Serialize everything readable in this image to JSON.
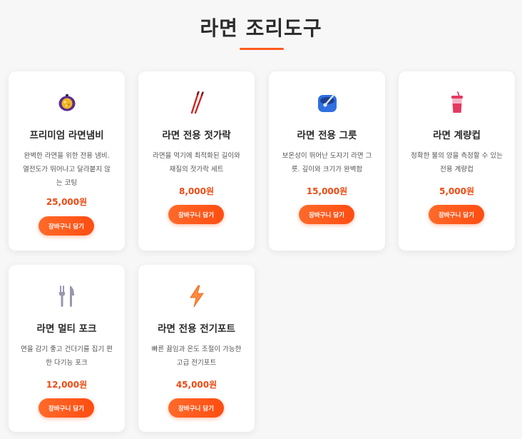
{
  "page": {
    "title": "라면 조리도구"
  },
  "colors": {
    "accent": "#ff5a1f",
    "price": "#ee4a12",
    "card_bg": "#ffffff",
    "page_bg": "#f7f7f7"
  },
  "products": [
    {
      "name": "프리미엄 라면냄비",
      "description": "완벽한 라면을 위한 전용 냄비. 열전도가 뛰어나고 달라붙지 않는 코팅",
      "price": "25,000원",
      "button_label": "장바구니 담기",
      "icon": "pot-icon"
    },
    {
      "name": "라면 전용 젓가락",
      "description": "라면을 먹기에 최적화된 길이와 재질의 젓가락 세트",
      "price": "8,000원",
      "button_label": "장바구니 담기",
      "icon": "chopsticks-icon"
    },
    {
      "name": "라면 전용 그릇",
      "description": "보온성이 뛰어난 도자기 라면 그릇. 깊이와 크기가 완벽함",
      "price": "15,000원",
      "button_label": "장바구니 담기",
      "icon": "bowl-icon"
    },
    {
      "name": "라면 계량컵",
      "description": "정확한 물의 양을 측정할 수 있는 전용 계량컵",
      "price": "5,000원",
      "button_label": "장바구니 담기",
      "icon": "cup-icon"
    },
    {
      "name": "라면 멀티 포크",
      "description": "면을 감기 좋고 건더기를 집기 편한 다기능 포크",
      "price": "12,000원",
      "button_label": "장바구니 담기",
      "icon": "fork-knife-icon"
    },
    {
      "name": "라면 전용 전기포트",
      "description": "빠른 끓임과 온도 조절이 가능한 고급 전기포트",
      "price": "45,000원",
      "button_label": "장바구니 담기",
      "icon": "lightning-icon"
    }
  ]
}
